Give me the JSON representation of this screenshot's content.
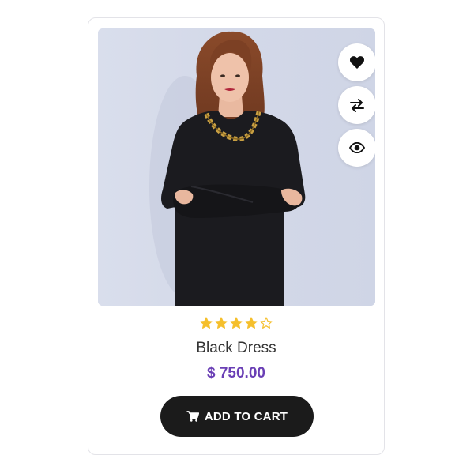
{
  "product": {
    "title": "Black Dress",
    "price": "$ 750.00",
    "rating": 4,
    "rating_max": 5
  },
  "actions": {
    "wishlist_icon": "heart-icon",
    "compare_icon": "arrows-exchange-icon",
    "quickview_icon": "eye-icon"
  },
  "cart_button": {
    "label": "ADD TO CART",
    "icon": "shopping-cart-icon"
  },
  "colors": {
    "price": "#6a3fb5",
    "star": "#f5bf2c",
    "button_bg": "#1b1b1b",
    "photo_bg": "#d6dbea"
  }
}
